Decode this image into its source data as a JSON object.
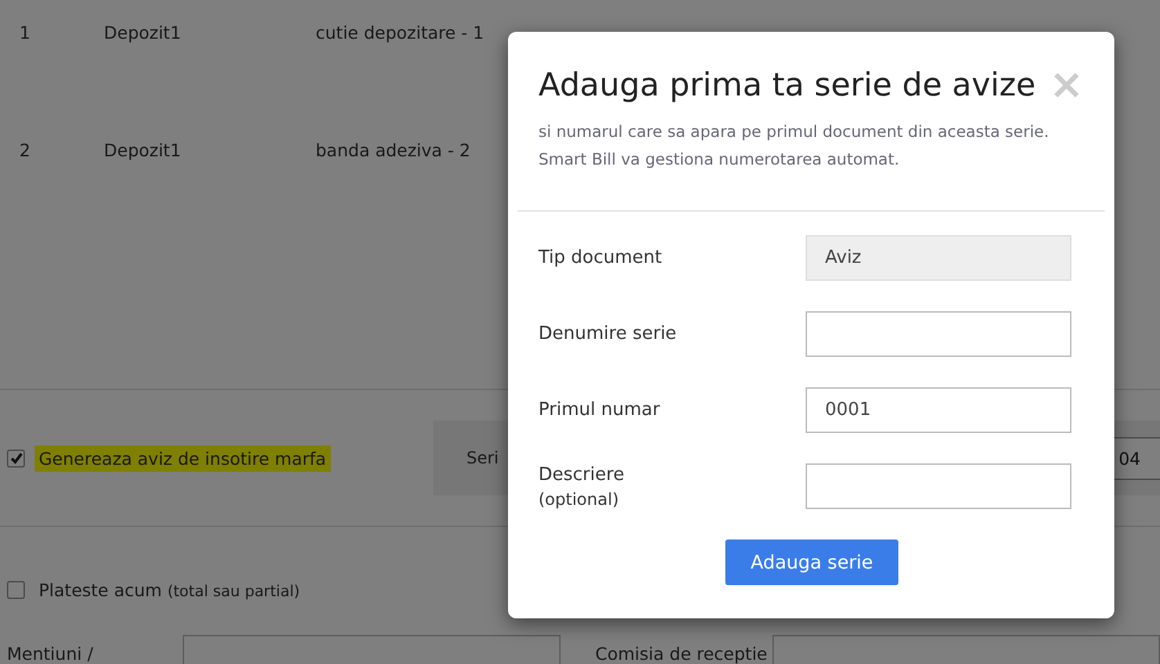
{
  "table": {
    "rows": [
      {
        "cells": [
          "1",
          "Depozit1",
          "cutie depozitare - 1"
        ]
      },
      {
        "cells": [
          "2",
          "Depozit1",
          "banda adeziva - 2"
        ]
      }
    ]
  },
  "delivery_note": {
    "label": "Genereaza aviz de insotire marfa",
    "checked": true,
    "highlighted": true
  },
  "series_panel": {
    "label": "Seri",
    "value": "04"
  },
  "pay_now": {
    "label": "Plateste acum",
    "note": "(total sau partial)",
    "checked": false
  },
  "bottom_fields": [
    {
      "label": "Mentiuni /"
    },
    {
      "label": "Comisia de receptie"
    }
  ],
  "modal": {
    "title": "Adauga prima ta serie de avize",
    "close": "×",
    "subtitle": [
      "si numarul care sa apara pe primul document din aceasta serie.",
      "Smart Bill va gestiona numerotarea automat."
    ],
    "fields": [
      {
        "label": "Tip document",
        "kind": "readonly",
        "value": "Aviz"
      },
      {
        "label": "Denumire serie",
        "kind": "input"
      },
      {
        "label": "Primul numar",
        "kind": "input",
        "value": "0001"
      },
      {
        "label": "Descriere",
        "note": "(optional)",
        "kind": "input"
      }
    ],
    "button": "Adauga serie"
  }
}
